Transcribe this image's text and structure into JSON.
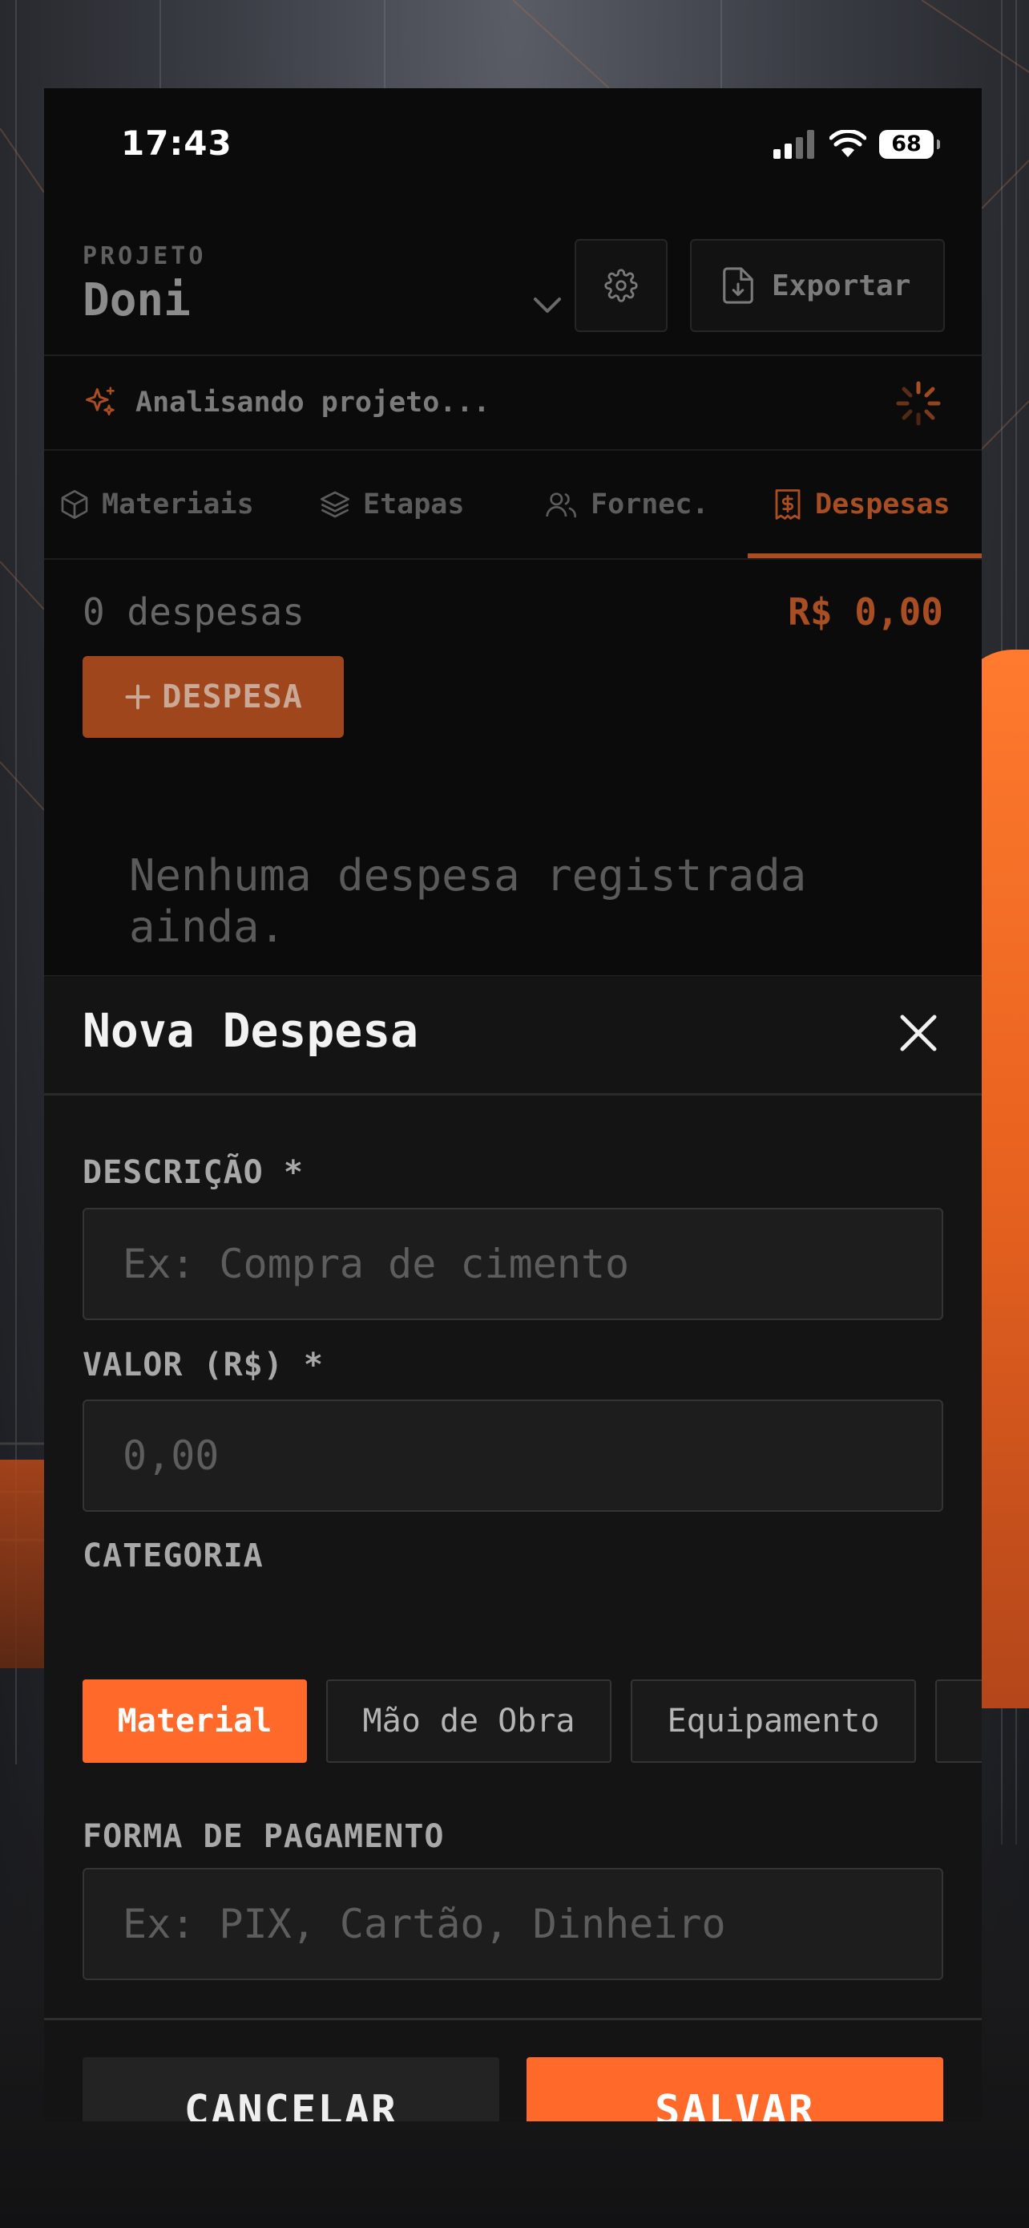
{
  "status_bar": {
    "time": "17:43",
    "battery": "68"
  },
  "header": {
    "project_label": "PROJETO",
    "project_name": "Doni",
    "export_label": "Exportar"
  },
  "analysis": {
    "text": "Analisando projeto..."
  },
  "tabs": [
    {
      "label": "Materiais",
      "icon": "box-icon"
    },
    {
      "label": "Etapas",
      "icon": "layers-icon"
    },
    {
      "label": "Fornec.",
      "icon": "users-icon"
    },
    {
      "label": "Despesas",
      "icon": "receipt-icon",
      "active": true
    }
  ],
  "summary": {
    "count": "0 despesas",
    "total": "R$ 0,00",
    "add_label": "DESPESA"
  },
  "empty_state": {
    "text": "Nenhuma despesa registrada ainda."
  },
  "sheet": {
    "title": "Nova Despesa",
    "description_label": "DESCRIÇÃO *",
    "description_placeholder": "Ex: Compra de cimento",
    "value_label": "VALOR (R$) *",
    "value_placeholder": "0,00",
    "category_label": "CATEGORIA",
    "categories": [
      "Material",
      "Mão de Obra",
      "Equipamento"
    ],
    "selected_category": "Material",
    "payment_label": "FORMA DE PAGAMENTO",
    "payment_placeholder": "Ex: PIX, Cartão, Dinheiro",
    "cancel_label": "CANCELAR",
    "save_label": "SALVAR"
  },
  "colors": {
    "accent": "#ff6a2b",
    "accent_dim": "#a94e22",
    "panel": "#0b0b0b",
    "sheet": "#141414"
  }
}
